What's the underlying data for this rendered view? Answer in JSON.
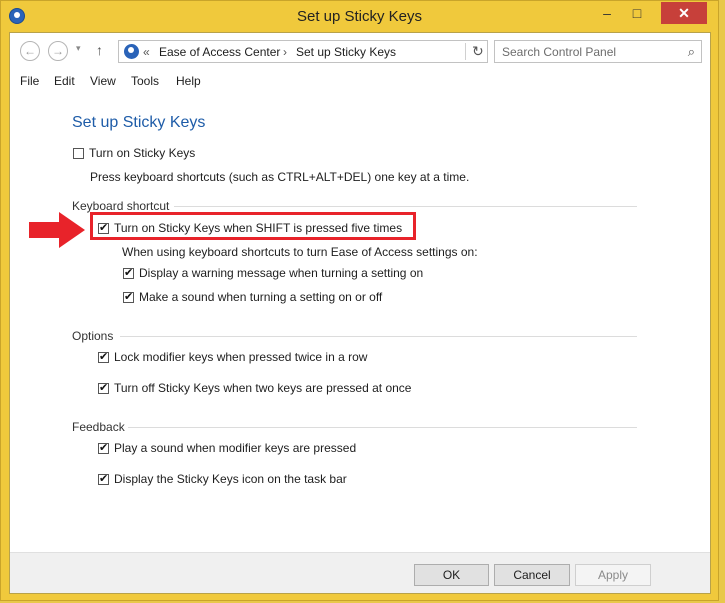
{
  "window": {
    "title": "Set up Sticky Keys"
  },
  "titlebar": {
    "minimize": "–",
    "maximize": "□",
    "close": "✕"
  },
  "nav": {
    "back": "←",
    "forward": "→",
    "recent": "▾",
    "up": "↑"
  },
  "address": {
    "chevron": "«",
    "crumbs": [
      "Ease of Access Center",
      "Set up Sticky Keys"
    ],
    "separator": "›",
    "refresh": "↻"
  },
  "search": {
    "placeholder": "Search Control Panel",
    "icon": "⌕"
  },
  "menu": [
    "File",
    "Edit",
    "View",
    "Tools",
    "Help"
  ],
  "page": {
    "title": "Set up Sticky Keys",
    "turn_on": {
      "label": "Turn on Sticky Keys",
      "checked": false
    },
    "turn_on_desc": "Press keyboard shortcuts (such as CTRL+ALT+DEL) one key at a time.",
    "keyboard_shortcut": {
      "title": "Keyboard shortcut",
      "shift_five": {
        "label": "Turn on Sticky Keys when SHIFT is pressed five times",
        "checked": true
      },
      "note": "When using keyboard shortcuts to turn Ease of Access settings on:",
      "warning": {
        "label": "Display a warning message when turning a setting on",
        "checked": true
      },
      "sound": {
        "label": "Make a sound when turning a setting on or off",
        "checked": true
      }
    },
    "options": {
      "title": "Options",
      "lock": {
        "label": "Lock modifier keys when pressed twice in a row",
        "checked": true
      },
      "turn_off": {
        "label": "Turn off Sticky Keys when two keys are pressed at once",
        "checked": true
      }
    },
    "feedback": {
      "title": "Feedback",
      "play_sound": {
        "label": "Play a sound when modifier keys are pressed",
        "checked": true
      },
      "icon": {
        "label": "Display the Sticky Keys icon on the task bar",
        "checked": true
      }
    }
  },
  "buttons": {
    "ok": "OK",
    "cancel": "Cancel",
    "apply": "Apply"
  },
  "check_glyph": "✔",
  "colors": {
    "highlight": "#e8232a",
    "title_blue": "#1e5ca8",
    "close_red": "#c7403a"
  }
}
